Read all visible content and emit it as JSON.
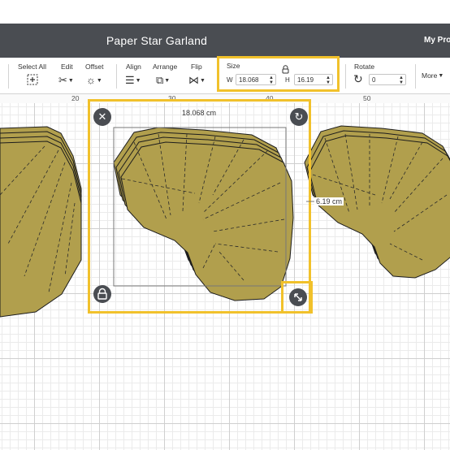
{
  "window": {
    "title": "Paper Star Garland",
    "projects_label": "My Pro"
  },
  "toolbar": {
    "select_all": "Select All",
    "edit": "Edit",
    "offset": "Offset",
    "align": "Align",
    "arrange": "Arrange",
    "flip": "Flip",
    "size": {
      "label": "Size",
      "w_label": "W",
      "w_value": "18.068",
      "h_label": "H",
      "h_value": "16.19"
    },
    "rotate": {
      "label": "Rotate",
      "value": "0"
    },
    "more": "More"
  },
  "ruler": {
    "ticks": [
      "20",
      "30",
      "40",
      "50"
    ]
  },
  "canvas": {
    "width_label": "18.068 cm",
    "height_label": "6.19 cm",
    "shape_color": "#b19f4d",
    "highlight_color": "#f1c12b"
  },
  "icons": {
    "close": "close-icon",
    "rotate": "rotate-icon",
    "lock": "lock-icon",
    "resize": "resize-icon"
  }
}
